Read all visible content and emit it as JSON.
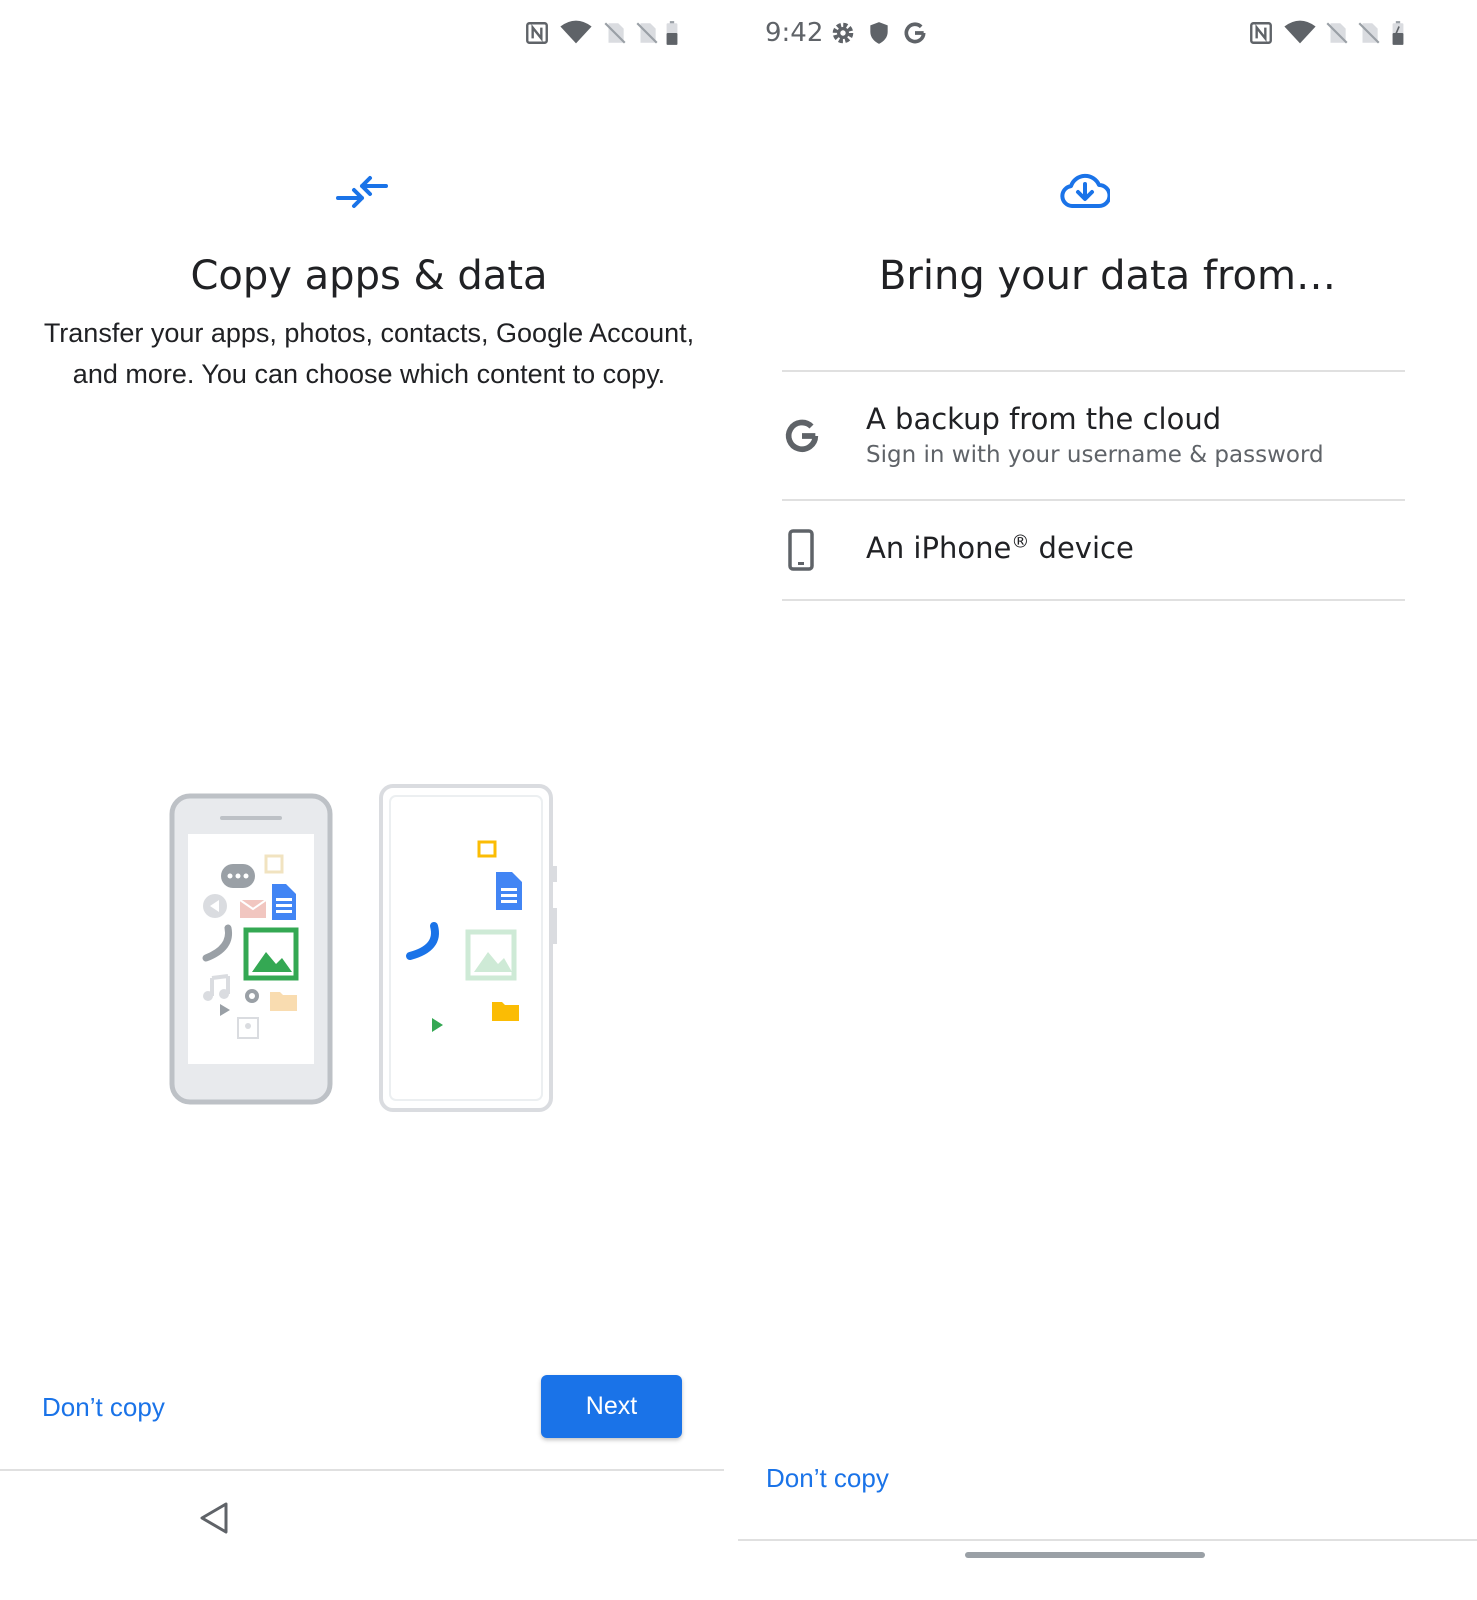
{
  "left_screen": {
    "status_icons": [
      "nfc-icon",
      "wifi-icon",
      "no-sim-icon",
      "no-sim-icon",
      "battery-icon"
    ],
    "hero_icon": "transfer-arrows-icon",
    "title": "Copy apps & data",
    "description": "Transfer your apps, photos, contacts, Google Account, and more. You can choose which content to copy.",
    "illustration": "phones-transfer-illustration",
    "dont_copy_label": "Don’t copy",
    "next_label": "Next",
    "nav_icon": "back-triangle-icon",
    "colors": {
      "accent": "#1a73e8"
    }
  },
  "right_screen": {
    "status": {
      "time": "9:42",
      "left_icons": [
        "settings-gear-icon",
        "shield-icon",
        "google-g-icon"
      ],
      "right_icons": [
        "nfc-icon",
        "wifi-icon",
        "no-sim-icon",
        "no-sim-icon",
        "battery-charging-icon"
      ]
    },
    "hero_icon": "cloud-download-icon",
    "title": "Bring your data from…",
    "options": [
      {
        "icon": "google-g-icon",
        "title": "A backup from the cloud",
        "subtitle": "Sign in with your username & password"
      },
      {
        "icon": "phone-icon",
        "title_main": "An iPhone",
        "title_sup": "®",
        "title_rest": " device"
      }
    ],
    "dont_copy_label": "Don’t copy",
    "nav": "home-pill"
  }
}
